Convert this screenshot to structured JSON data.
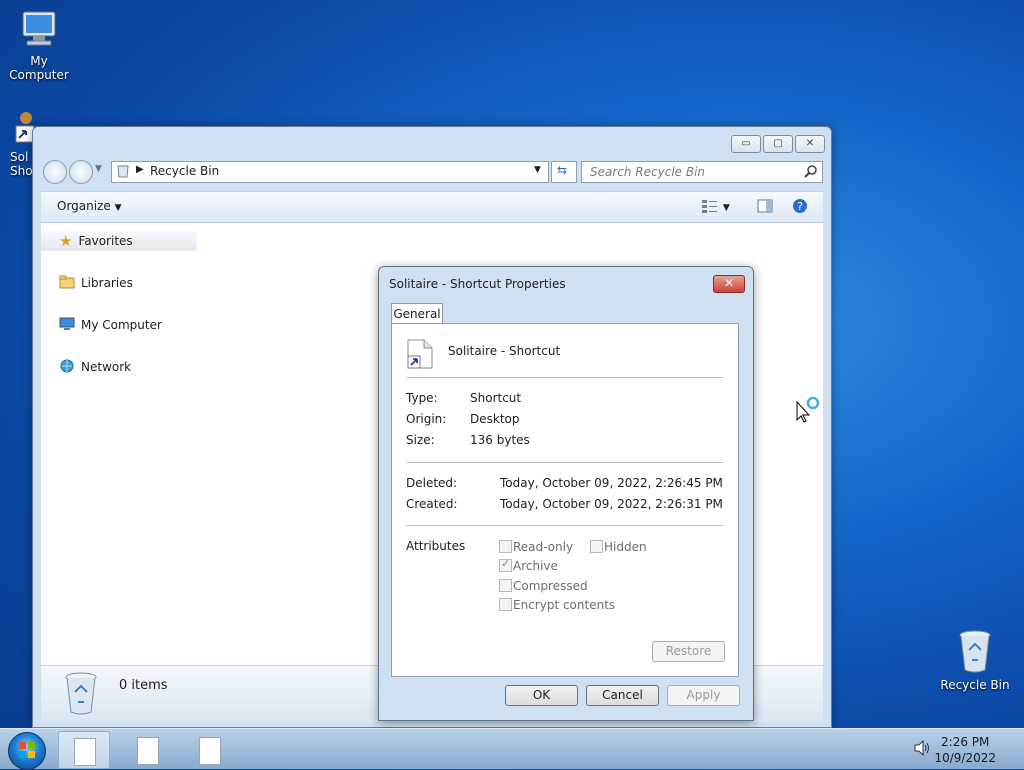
{
  "desktop": {
    "icons": [
      {
        "label": "My Computer"
      },
      {
        "label": "Recycle Bin"
      },
      {
        "label": "Sol\nSho"
      }
    ]
  },
  "explorer": {
    "address": "Recycle Bin",
    "search_placeholder": "Search Recycle Bin",
    "toolbar": {
      "organize": "Organize"
    },
    "nav": [
      {
        "label": "Favorites",
        "icon": "star-icon"
      },
      {
        "label": "Libraries",
        "icon": "libraries-icon"
      },
      {
        "label": "My Computer",
        "icon": "computer-icon"
      },
      {
        "label": "Network",
        "icon": "network-icon"
      }
    ],
    "details": {
      "items_count": "0 items"
    }
  },
  "dialog": {
    "title": "Solitaire - Shortcut Properties",
    "tab": "General",
    "file_name": "Solitaire - Shortcut",
    "fields": {
      "type_label": "Type:",
      "type_value": "Shortcut",
      "origin_label": "Origin:",
      "origin_value": "Desktop",
      "size_label": "Size:",
      "size_value": "136 bytes",
      "deleted_label": "Deleted:",
      "deleted_value": "Today, October 09, 2022, 2:26:45 PM",
      "created_label": "Created:",
      "created_value": "Today, October 09, 2022, 2:26:31 PM",
      "attributes_label": "Attributes"
    },
    "attributes": {
      "read_only": "Read-only",
      "hidden": "Hidden",
      "archive": "Archive",
      "compressed": "Compressed",
      "encrypt": "Encrypt contents"
    },
    "buttons": {
      "restore": "Restore",
      "ok": "OK",
      "cancel": "Cancel",
      "apply": "Apply"
    }
  },
  "taskbar": {
    "time": "2:26 PM",
    "date": "10/9/2022"
  }
}
